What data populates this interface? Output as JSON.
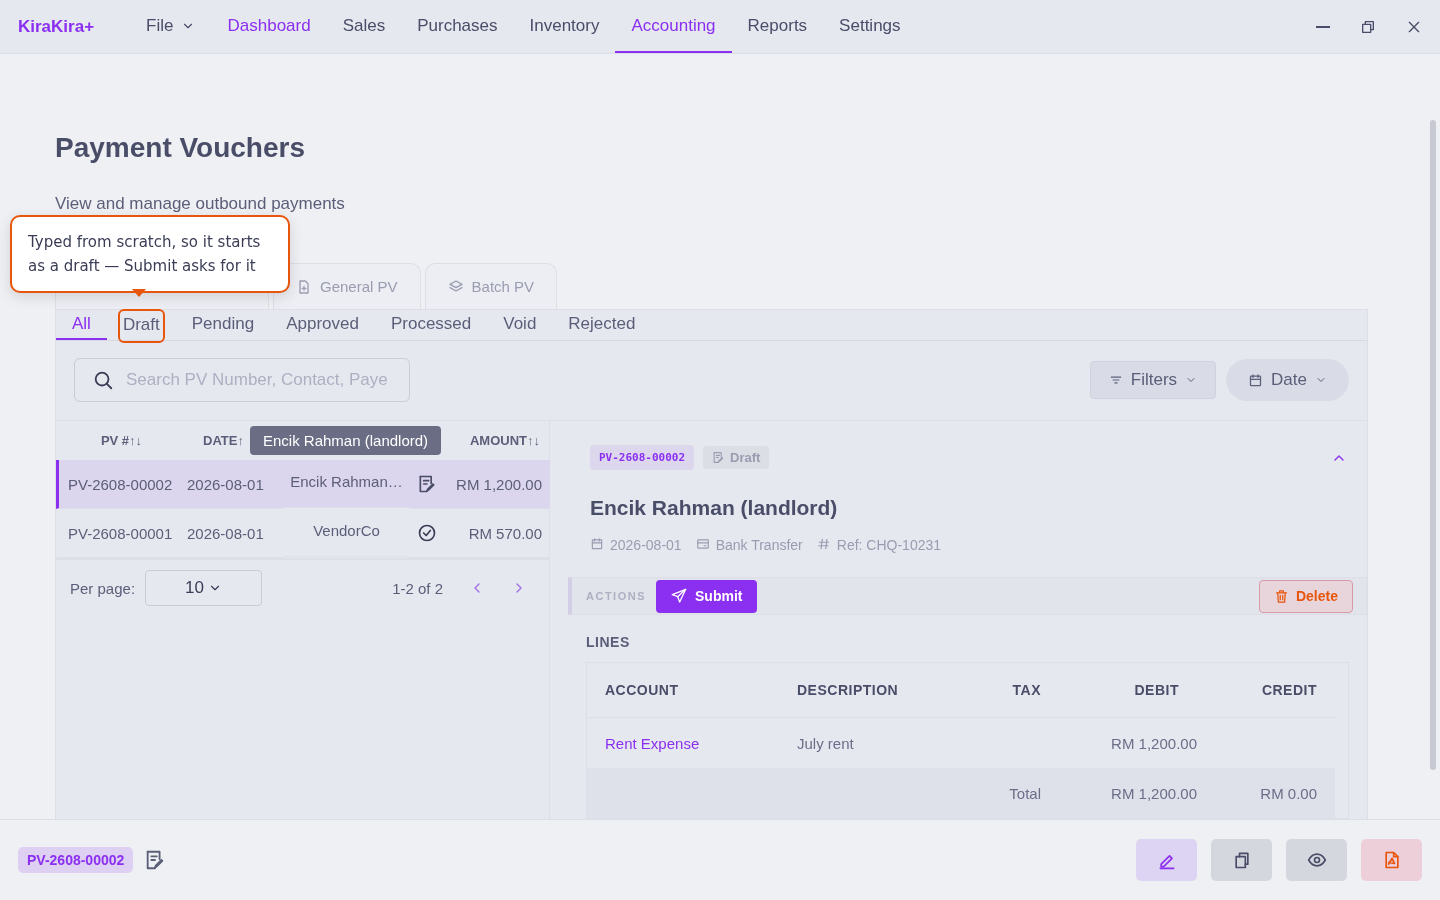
{
  "app": {
    "logo": "KiraKira+"
  },
  "menu": [
    {
      "label": "File",
      "kind": "dropdown",
      "selected": false,
      "hovered": false
    },
    {
      "label": "Dashboard",
      "kind": "link",
      "selected": false,
      "hovered": true
    },
    {
      "label": "Sales",
      "kind": "link",
      "selected": false,
      "hovered": false
    },
    {
      "label": "Purchases",
      "kind": "link",
      "selected": false,
      "hovered": false
    },
    {
      "label": "Inventory",
      "kind": "link",
      "selected": false,
      "hovered": false
    },
    {
      "label": "Accounting",
      "kind": "link",
      "selected": true,
      "hovered": false
    },
    {
      "label": "Reports",
      "kind": "link",
      "selected": false,
      "hovered": false
    },
    {
      "label": "Settings",
      "kind": "link",
      "selected": false,
      "hovered": false
    }
  ],
  "page": {
    "title": "Payment Vouchers",
    "subtitle": "View and manage outbound payments"
  },
  "callout": {
    "text": "Typed from scratch, so it starts as a draft — Submit asks for it"
  },
  "source_tabs": [
    {
      "label": "General PV",
      "kind": "general"
    },
    {
      "label": "Batch PV",
      "kind": "batch"
    }
  ],
  "status_tabs": [
    {
      "label": "All",
      "selected": true,
      "highlighted": false
    },
    {
      "label": "Draft",
      "selected": false,
      "highlighted": true
    },
    {
      "label": "Pending",
      "selected": false,
      "highlighted": false
    },
    {
      "label": "Approved",
      "selected": false,
      "highlighted": false
    },
    {
      "label": "Processed",
      "selected": false,
      "highlighted": false
    },
    {
      "label": "Void",
      "selected": false,
      "highlighted": false
    },
    {
      "label": "Rejected",
      "selected": false,
      "highlighted": false
    }
  ],
  "search": {
    "placeholder": "Search PV Number, Contact, Paye"
  },
  "filters": {
    "label": "Filters"
  },
  "date_filter": {
    "label": "Date"
  },
  "table": {
    "columns": [
      "PV #↑↓",
      "DATE↑",
      "AMOUNT↑↓"
    ],
    "tooltip": "Encik Rahman (landlord)",
    "rows": [
      {
        "pv": "PV-2608-00002",
        "date": "2026-08-01",
        "payee": "Encik Rahman…",
        "kind": "draft",
        "amount": "RM 1,200.00",
        "selected": true
      },
      {
        "pv": "PV-2608-00001",
        "date": "2026-08-01",
        "payee": "VendorCo",
        "kind": "processed",
        "amount": "RM 570.00",
        "selected": false
      }
    ]
  },
  "pager": {
    "label": "Per page:",
    "per_page": "10",
    "range": "1-2 of 2"
  },
  "detail": {
    "number": "PV-2608-00002",
    "status": "Draft",
    "payee": "Encik Rahman (landlord)",
    "date": "2026-08-01",
    "method": "Bank Transfer",
    "ref": "Ref: CHQ-10231",
    "actions_label": "ACTIONS",
    "submit": "Submit",
    "delete": "Delete",
    "lines_title": "LINES",
    "columns": [
      "ACCOUNT",
      "DESCRIPTION",
      "TAX",
      "DEBIT",
      "CREDIT"
    ],
    "lines": [
      {
        "account": "Rent Expense",
        "description": "July rent",
        "debit": "RM 1,200.00"
      }
    ],
    "total": {
      "label": "Total",
      "debit": "RM 1,200.00",
      "credit": "RM 0.00"
    }
  },
  "footer": {
    "number": "PV-2608-00002",
    "actions": [
      {
        "kind": "edit"
      },
      {
        "kind": "copy"
      },
      {
        "kind": "view"
      },
      {
        "kind": "pdf"
      }
    ]
  }
}
